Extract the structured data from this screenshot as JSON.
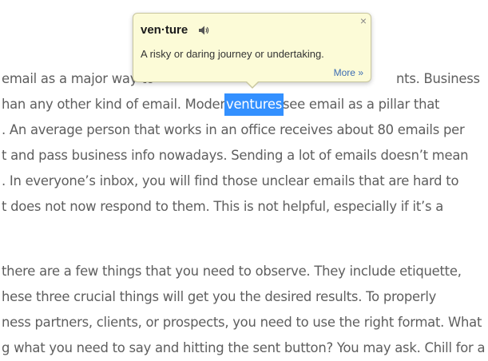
{
  "article": {
    "lines": [
      "email as a major way to",
      "han any other kind of email. Modern",
      ". An average person that works in an office receives about 80 emails per",
      "t and pass business info nowadays. Sending a lot of emails doesn’t mean",
      ". In everyone’s inbox, you will find those unclear emails that are hard to",
      "t does not now respond to them. This is not helpful, especially if it’s a",
      " there are a few things that you need to observe. They include etiquette,",
      "hese three crucial things will get you the desired results. To properly",
      "ness partners, clients, or prospects, you need to use the right format. What",
      "g what you need to say and hitting the sent button? You may ask. Chill for a"
    ],
    "line1_tail": "nts. Business",
    "selected_word": "ventures",
    "line2_tail": "see email as a pillar that"
  },
  "popup": {
    "headword": "ven·ture",
    "speaker_icon": "speaker-icon",
    "close_label": "×",
    "definition": "A risky or daring journey or undertaking.",
    "more_label": "More »"
  },
  "colors": {
    "selection": "#3390ff",
    "popup_bg": "#fcfbd7",
    "link": "#3c6cb3",
    "text": "#5e5e5e"
  }
}
